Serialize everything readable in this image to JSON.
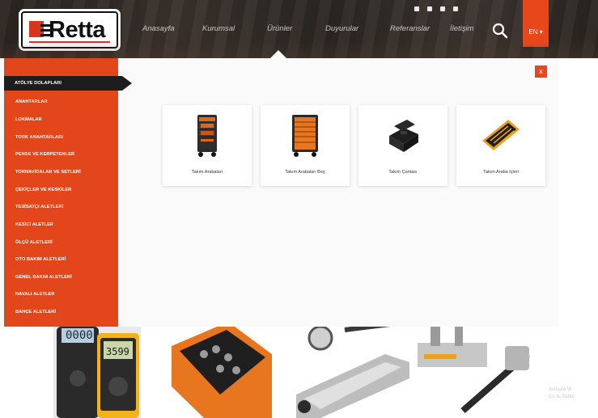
{
  "header": {
    "logo_text": "Retta",
    "nav": [
      {
        "label": "Anasayfa"
      },
      {
        "label": "Kurumsal"
      },
      {
        "label": "Ürünler"
      },
      {
        "label": "Duyurular"
      },
      {
        "label": "Referanslar"
      },
      {
        "label": "İletişim"
      }
    ],
    "language": "EN ▾"
  },
  "menu": {
    "active_item": "ATÖLYE DOLAPLARI",
    "items": [
      {
        "label": "ANAHTARLAR"
      },
      {
        "label": "LOKMALAR"
      },
      {
        "label": "TORK ANAHTARLARI"
      },
      {
        "label": "PENSE VE KERPETENLER"
      },
      {
        "label": "TORNAVİDALAR VE SETLERİ"
      },
      {
        "label": "ÇEKİÇLER VE KESKİLER"
      },
      {
        "label": "TESİSATÇI ALETLERİ"
      },
      {
        "label": "KESİCİ ALETLER"
      },
      {
        "label": "ÖLÇÜ ALETLERİ"
      },
      {
        "label": "OTO BAKIM ALETLERİ"
      },
      {
        "label": "GENEL BAKIM ALETLERİ"
      },
      {
        "label": "HAVALI ALETLER"
      },
      {
        "label": "BAHÇE ALETLERİ"
      }
    ],
    "close_label": "x"
  },
  "categories": [
    {
      "label": "Takım Arabaları",
      "icon": "tool-trolley-icon"
    },
    {
      "label": "Takım Arabaları Boş",
      "icon": "empty-tool-cabinet-icon"
    },
    {
      "label": "Takım Çantası",
      "icon": "tool-case-icon"
    },
    {
      "label": "Takım Araba İçleri",
      "icon": "tool-tray-icon"
    }
  ],
  "products": {
    "multimeter_left_display": "0000",
    "multimeter_right_display": "3599"
  },
  "colors": {
    "accent": "#e2461a",
    "active_menu": "#1d1d1d",
    "header_bg": "#2c2724"
  }
}
